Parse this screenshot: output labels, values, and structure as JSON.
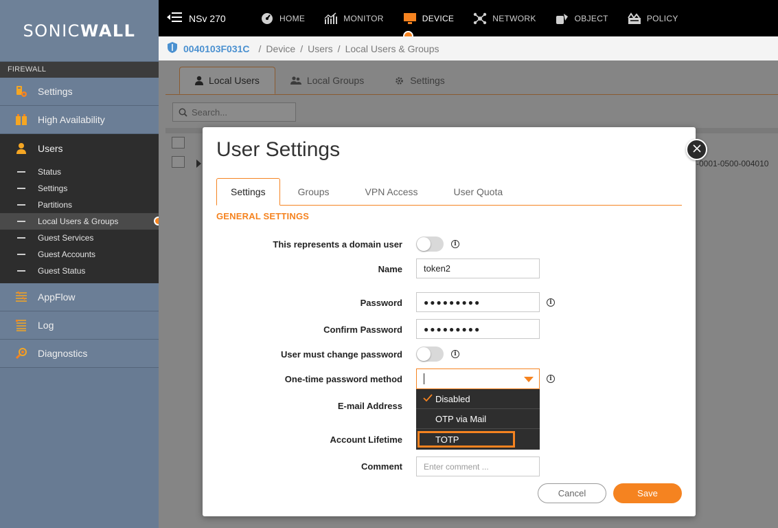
{
  "app": {
    "logo_text_light": "SONIC",
    "logo_text_bold": "WALL",
    "logo_mark": "·",
    "product": "NSv 270"
  },
  "colors": {
    "accent": "#f58320",
    "sidebar": "#687b93",
    "topbar": "#000000",
    "link": "#4a90d0"
  },
  "top_nav": [
    {
      "label": "HOME",
      "icon": "dashboard-icon"
    },
    {
      "label": "MONITOR",
      "icon": "monitor-chart-icon"
    },
    {
      "label": "DEVICE",
      "icon": "device-monitor-icon",
      "active": true
    },
    {
      "label": "NETWORK",
      "icon": "network-icon"
    },
    {
      "label": "OBJECT",
      "icon": "object-icon"
    },
    {
      "label": "POLICY",
      "icon": "policy-icon"
    }
  ],
  "breadcrumb": {
    "serial": "0040103F031C",
    "sep": "/",
    "items": [
      "Device",
      "Users",
      "Local Users & Groups"
    ]
  },
  "sidebar": {
    "section": "FIREWALL",
    "items": [
      {
        "label": "Settings",
        "icon": "settings-icon"
      },
      {
        "label": "High Availability",
        "icon": "high-availability-icon"
      },
      {
        "label": "Users",
        "icon": "user-icon"
      },
      {
        "label": "AppFlow",
        "icon": "appflow-icon"
      },
      {
        "label": "Log",
        "icon": "log-icon"
      },
      {
        "label": "Diagnostics",
        "icon": "diagnostics-icon"
      }
    ],
    "users_sub": [
      "Status",
      "Settings",
      "Partitions",
      "Local Users & Groups",
      "Guest Services",
      "Guest Accounts",
      "Guest Status"
    ]
  },
  "main": {
    "tabs": [
      "Local Users",
      "Local Groups",
      "Settings"
    ],
    "search_placeholder": "Search...",
    "row_text": "-0001-0500-004010"
  },
  "modal": {
    "title": "User Settings",
    "tabs": [
      "Settings",
      "Groups",
      "VPN Access",
      "User Quota"
    ],
    "section": "GENERAL SETTINGS",
    "labels": {
      "domain_user": "This represents a domain user",
      "name": "Name",
      "password": "Password",
      "confirm_password": "Confirm Password",
      "must_change": "User must change password",
      "otp_method": "One-time password method",
      "email": "E-mail Address",
      "lifetime": "Account Lifetime",
      "comment": "Comment"
    },
    "values": {
      "name": "token2",
      "password": "●●●●●●●●●",
      "confirm_password": "●●●●●●●●●",
      "domain_user": false,
      "must_change": false
    },
    "comment_placeholder": "Enter comment ...",
    "otp_options": [
      "Disabled",
      "OTP via Mail",
      "TOTP"
    ],
    "otp_selected": "Disabled",
    "otp_highlighted": "TOTP",
    "info_glyph": "i",
    "cancel": "Cancel",
    "save": "Save"
  }
}
